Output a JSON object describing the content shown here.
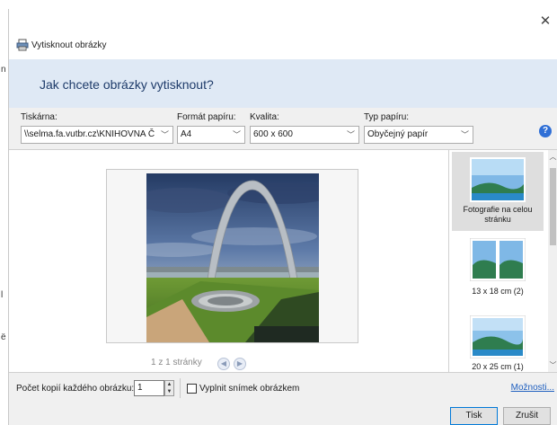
{
  "background": {
    "fragments": [
      "n",
      "l",
      "ë"
    ]
  },
  "titlebar": {
    "close_glyph": "✕"
  },
  "app": {
    "title": "Vytisknout obrázky",
    "icon": "printer-icon"
  },
  "banner": {
    "text": "Jak chcete obrázky vytisknout?"
  },
  "options": {
    "printer": {
      "label": "Tiskárna:",
      "value": "\\\\selma.fa.vutbr.cz\\KNIHOVNA Č"
    },
    "paper_size": {
      "label": "Formát papíru:",
      "value": "A4"
    },
    "quality": {
      "label": "Kvalita:",
      "value": "600 x 600"
    },
    "paper_type": {
      "label": "Typ papíru:",
      "value": "Obyčejný papír"
    },
    "help": "?"
  },
  "preview": {
    "page_indicator": "1 z 1 stránky",
    "prev_glyph": "◀",
    "next_glyph": "▶"
  },
  "layouts": {
    "items": [
      {
        "label": "Fotografie na celou stránku",
        "selected": true
      },
      {
        "label": "13 x 18 cm (2)",
        "selected": false
      },
      {
        "label": "20 x 25 cm (1)",
        "selected": false
      }
    ]
  },
  "bottom": {
    "copies_label": "Počet kopií každého obrázku:",
    "copies_value": "1",
    "fill_label": "Vyplnit snímek obrázkem",
    "fill_checked": false,
    "options_link": "Možnosti...",
    "print_button": "Tisk",
    "cancel_button": "Zrušit"
  },
  "colors": {
    "banner_bg": "#dfe9f5",
    "banner_text": "#1e3b6a",
    "link": "#1f5fbf",
    "accent": "#0078d7",
    "help_icon": "#2f6fd6"
  }
}
